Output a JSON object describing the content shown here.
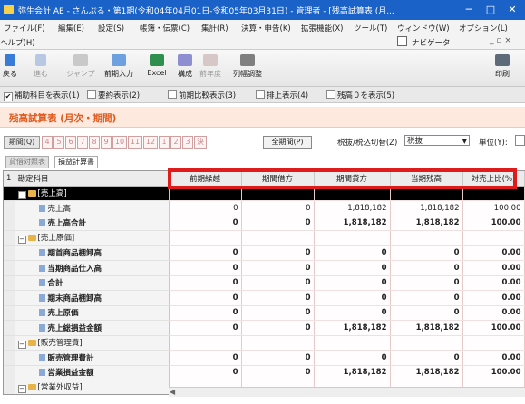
{
  "window": {
    "title": "弥生会計 AE - さんぷる・第1期(令和04年04月01日-令和05年03月31日) - 管理者 - [残高試算表 (月...",
    "minimize": "─",
    "maximize": "□",
    "close": "✕"
  },
  "menu": [
    "ファイル(F)",
    "編集(E)",
    "設定(S)",
    "帳簿・伝票(C)",
    "集計(R)",
    "決算・申告(K)",
    "拡張機能(X)",
    "ツール(T)",
    "ウィンドウ(W)",
    "オプション(L)"
  ],
  "menu2": {
    "help": "ヘルプ(H)",
    "navigator": "ナビゲータ",
    "controls": "_ ▫ ×"
  },
  "toolbar": {
    "back": "戻る",
    "forward": "進む",
    "jump": "ジャンプ",
    "prev_input": "前期入力",
    "excel": "Excel",
    "structure": "構成",
    "prev_year": "前年度",
    "col_adjust": "列幅調整",
    "print": "印刷"
  },
  "options": [
    {
      "label": "補助科目を表示(1)",
      "checked": true
    },
    {
      "label": "要約表示(2)",
      "checked": false
    },
    {
      "label": "前期比較表示(3)",
      "checked": false
    },
    {
      "label": "排上表示(4)",
      "checked": false
    },
    {
      "label": "残高０を表示(5)",
      "checked": false
    }
  ],
  "page_title": "残高試算表 (月次・期間)",
  "period": {
    "label": "期間(Q)",
    "months": [
      "4",
      "5",
      "6",
      "7",
      "8",
      "9",
      "10",
      "11",
      "12",
      "1",
      "2",
      "3",
      "決"
    ],
    "all_period": "全期間(P)",
    "tax_label": "税抜/税込切替(Z)",
    "tax_value": "税抜",
    "unit_label": "単位(Y):"
  },
  "tabs": [
    "貸借対照表",
    "損益計算書"
  ],
  "grid": {
    "corner": "1",
    "columns": [
      "勘定科目",
      "前期繰越",
      "期間借方",
      "期間貸方",
      "当期残高",
      "対売上比(%)"
    ],
    "rows": [
      {
        "name": "[売上高]",
        "type": "group",
        "selected": true,
        "values": [
          "",
          "",
          "",
          "",
          ""
        ]
      },
      {
        "name": "売上高",
        "type": "item",
        "bold": false,
        "values": [
          "0",
          "0",
          "1,818,182",
          "1,818,182",
          "100.00"
        ]
      },
      {
        "name": "売上高合計",
        "type": "item",
        "bold": true,
        "values": [
          "0",
          "0",
          "1,818,182",
          "1,818,182",
          "100.00"
        ]
      },
      {
        "name": "[売上原価]",
        "type": "group",
        "selected": false,
        "values": [
          "",
          "",
          "",
          "",
          ""
        ]
      },
      {
        "name": "期首商品棚卸高",
        "type": "item",
        "bold": true,
        "values": [
          "0",
          "0",
          "0",
          "0",
          "0.00"
        ]
      },
      {
        "name": "当期商品仕入高",
        "type": "item",
        "bold": true,
        "values": [
          "0",
          "0",
          "0",
          "0",
          "0.00"
        ]
      },
      {
        "name": "合計",
        "type": "item",
        "bold": true,
        "values": [
          "0",
          "0",
          "0",
          "0",
          "0.00"
        ]
      },
      {
        "name": "期末商品棚卸高",
        "type": "item",
        "bold": true,
        "values": [
          "0",
          "0",
          "0",
          "0",
          "0.00"
        ]
      },
      {
        "name": "売上原価",
        "type": "item",
        "bold": true,
        "values": [
          "0",
          "0",
          "0",
          "0",
          "0.00"
        ]
      },
      {
        "name": "売上総損益金額",
        "type": "item",
        "bold": true,
        "values": [
          "0",
          "0",
          "1,818,182",
          "1,818,182",
          "100.00"
        ]
      },
      {
        "name": "[販売管理費]",
        "type": "group",
        "selected": false,
        "values": [
          "",
          "",
          "",
          "",
          ""
        ]
      },
      {
        "name": "販売管理費計",
        "type": "item",
        "bold": true,
        "values": [
          "0",
          "0",
          "0",
          "0",
          "0.00"
        ]
      },
      {
        "name": "営業損益金額",
        "type": "item",
        "bold": true,
        "values": [
          "0",
          "0",
          "1,818,182",
          "1,818,182",
          "100.00"
        ]
      },
      {
        "name": "[営業外収益]",
        "type": "group",
        "selected": false,
        "values": [
          "",
          "",
          "",
          "",
          ""
        ]
      }
    ]
  },
  "colors": {
    "titlebar": "#1a62c8",
    "header_orange": "#e05a1d",
    "highlight_red": "#e01b1b"
  }
}
